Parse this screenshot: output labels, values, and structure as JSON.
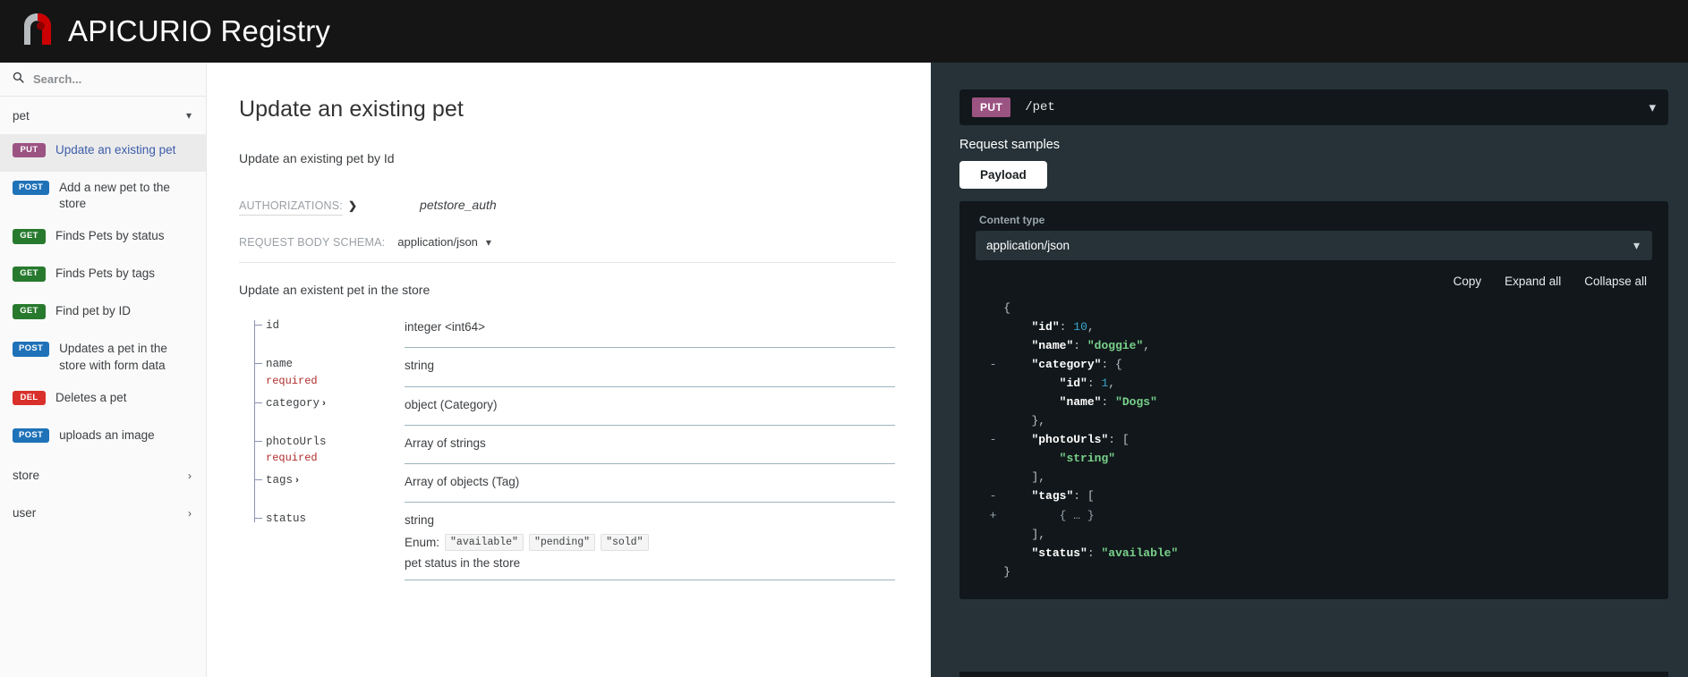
{
  "header": {
    "brand_light": "APICURIO ",
    "brand_bold": "Registry",
    "logo_icon": "apicurio-logo-icon"
  },
  "sidebar": {
    "search": {
      "placeholder": "Search...",
      "value": "",
      "icon": "search-icon"
    },
    "groups": [
      {
        "label": "pet",
        "expanded": true,
        "icon": "chevron-down-icon"
      },
      {
        "label": "store",
        "expanded": false,
        "icon": "chevron-right-icon"
      },
      {
        "label": "user",
        "expanded": false,
        "icon": "chevron-right-icon"
      }
    ],
    "operations": [
      {
        "method": "PUT",
        "method_class": "put",
        "label": "Update an existing pet",
        "active": true
      },
      {
        "method": "POST",
        "method_class": "post",
        "label": "Add a new pet to the store",
        "active": false
      },
      {
        "method": "GET",
        "method_class": "get",
        "label": "Finds Pets by status",
        "active": false
      },
      {
        "method": "GET",
        "method_class": "get",
        "label": "Finds Pets by tags",
        "active": false
      },
      {
        "method": "GET",
        "method_class": "get",
        "label": "Find pet by ID",
        "active": false
      },
      {
        "method": "POST",
        "method_class": "post",
        "label": "Updates a pet in the store with form data",
        "active": false
      },
      {
        "method": "DEL",
        "method_class": "del",
        "label": "Deletes a pet",
        "active": false
      },
      {
        "method": "POST",
        "method_class": "post",
        "label": "uploads an image",
        "active": false
      }
    ]
  },
  "main": {
    "title": "Update an existing pet",
    "description": "Update an existing pet by Id",
    "authorizations_label": "AUTHORIZATIONS:",
    "authorizations_value": "petstore_auth",
    "authorizations_caret": "❯",
    "schema_label": "REQUEST BODY SCHEMA:",
    "schema_value": "application/json",
    "schema_caret": "⌄",
    "schema_description": "Update an existent pet in the store",
    "fields": [
      {
        "name": "id",
        "required": "",
        "expandable": false,
        "type": "integer <int64>",
        "enum_label": "",
        "enum": [],
        "desc": ""
      },
      {
        "name": "name",
        "required": "required",
        "expandable": false,
        "type": "string",
        "enum_label": "",
        "enum": [],
        "desc": ""
      },
      {
        "name": "category",
        "required": "",
        "expandable": true,
        "type": "object (Category)",
        "enum_label": "",
        "enum": [],
        "desc": ""
      },
      {
        "name": "photoUrls",
        "required": "required",
        "expandable": false,
        "type": "Array of strings",
        "enum_label": "",
        "enum": [],
        "desc": ""
      },
      {
        "name": "tags",
        "required": "",
        "expandable": true,
        "type": "Array of objects (Tag)",
        "enum_label": "",
        "enum": [],
        "desc": ""
      },
      {
        "name": "status",
        "required": "",
        "expandable": false,
        "type": "string",
        "enum_label": "Enum:",
        "enum": [
          "\"available\"",
          "\"pending\"",
          "\"sold\""
        ],
        "desc": "pet status in the store"
      }
    ]
  },
  "right_panel": {
    "endpoint": {
      "method": "PUT",
      "path": "/pet",
      "caret_icon": "chevron-down-icon"
    },
    "samples_title": "Request samples",
    "tabs": [
      {
        "label": "Payload",
        "active": true
      }
    ],
    "content_type": {
      "label": "Content type",
      "value": "application/json",
      "caret_icon": "chevron-down-icon"
    },
    "actions": [
      "Copy",
      "Expand all",
      "Collapse all"
    ],
    "code_lines": [
      {
        "fold": "",
        "indent": 0,
        "parts": [
          {
            "t": "pun",
            "v": "{"
          }
        ]
      },
      {
        "fold": "",
        "indent": 1,
        "parts": [
          {
            "t": "key",
            "v": "\"id\""
          },
          {
            "t": "pun",
            "v": ": "
          },
          {
            "t": "num",
            "v": "10"
          },
          {
            "t": "pun",
            "v": ","
          }
        ]
      },
      {
        "fold": "",
        "indent": 1,
        "parts": [
          {
            "t": "key",
            "v": "\"name\""
          },
          {
            "t": "pun",
            "v": ": "
          },
          {
            "t": "str",
            "v": "\"doggie\""
          },
          {
            "t": "pun",
            "v": ","
          }
        ]
      },
      {
        "fold": "-",
        "indent": 1,
        "parts": [
          {
            "t": "key",
            "v": "\"category\""
          },
          {
            "t": "pun",
            "v": ": {"
          }
        ]
      },
      {
        "fold": "",
        "indent": 2,
        "parts": [
          {
            "t": "key",
            "v": "\"id\""
          },
          {
            "t": "pun",
            "v": ": "
          },
          {
            "t": "num",
            "v": "1"
          },
          {
            "t": "pun",
            "v": ","
          }
        ]
      },
      {
        "fold": "",
        "indent": 2,
        "parts": [
          {
            "t": "key",
            "v": "\"name\""
          },
          {
            "t": "pun",
            "v": ": "
          },
          {
            "t": "str",
            "v": "\"Dogs\""
          }
        ]
      },
      {
        "fold": "",
        "indent": 1,
        "parts": [
          {
            "t": "pun",
            "v": "},"
          }
        ]
      },
      {
        "fold": "-",
        "indent": 1,
        "parts": [
          {
            "t": "key",
            "v": "\"photoUrls\""
          },
          {
            "t": "pun",
            "v": ": ["
          }
        ]
      },
      {
        "fold": "",
        "indent": 2,
        "parts": [
          {
            "t": "str",
            "v": "\"string\""
          }
        ]
      },
      {
        "fold": "",
        "indent": 1,
        "parts": [
          {
            "t": "pun",
            "v": "],"
          }
        ]
      },
      {
        "fold": "-",
        "indent": 1,
        "parts": [
          {
            "t": "key",
            "v": "\"tags\""
          },
          {
            "t": "pun",
            "v": ": ["
          }
        ]
      },
      {
        "fold": "+",
        "indent": 2,
        "parts": [
          {
            "t": "fold",
            "v": "{ … }"
          }
        ]
      },
      {
        "fold": "",
        "indent": 1,
        "parts": [
          {
            "t": "pun",
            "v": "],"
          }
        ]
      },
      {
        "fold": "",
        "indent": 1,
        "parts": [
          {
            "t": "key",
            "v": "\"status\""
          },
          {
            "t": "pun",
            "v": ": "
          },
          {
            "t": "str",
            "v": "\"available\""
          }
        ]
      },
      {
        "fold": "",
        "indent": 0,
        "parts": [
          {
            "t": "pun",
            "v": "}"
          }
        ]
      }
    ]
  },
  "colors": {
    "header_bg": "#151515",
    "panel_bg": "#263238",
    "code_bg": "#11171a",
    "put": "#9b5382",
    "post": "#1f72b8",
    "get": "#27792d",
    "del": "#d9302c",
    "link": "#3d5dab",
    "required": "#b02c2c",
    "string_token": "#79d18b",
    "number_token": "#3aa6d0"
  }
}
